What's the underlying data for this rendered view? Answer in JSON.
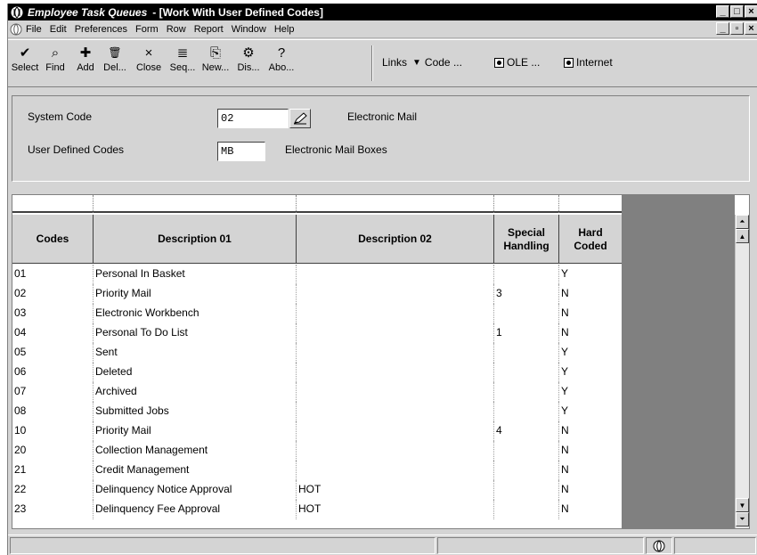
{
  "titlebar": {
    "app_title": "Employee Task Queues",
    "form_title": "- [Work With User Defined Codes]",
    "controls": [
      "_",
      "□",
      "×"
    ]
  },
  "menubar": {
    "items": [
      "File",
      "Edit",
      "Preferences",
      "Form",
      "Row",
      "Report",
      "Window",
      "Help"
    ],
    "mdi_controls": [
      "_",
      "▫",
      "×"
    ]
  },
  "toolbar": {
    "buttons": [
      {
        "label": "Select",
        "icon": "checkmark-icon",
        "glyph": "✔"
      },
      {
        "label": "Find",
        "icon": "find-icon",
        "glyph": "⌕"
      },
      {
        "label": "Add",
        "icon": "add-icon",
        "glyph": "✚"
      },
      {
        "label": "Del...",
        "icon": "trash-icon",
        "glyph": "🗑"
      },
      {
        "label": "Close",
        "icon": "close-icon",
        "glyph": "×"
      },
      {
        "label": "Seq...",
        "icon": "sequence-icon",
        "glyph": "≣"
      },
      {
        "label": "New...",
        "icon": "new-icon",
        "glyph": "⎘"
      },
      {
        "label": "Dis...",
        "icon": "display-icon",
        "glyph": "⚙"
      },
      {
        "label": "Abo...",
        "icon": "about-icon",
        "glyph": "?"
      }
    ],
    "links_label": "Links",
    "code_label": "Code ...",
    "ole_label": "OLE ...",
    "internet_label": "Internet"
  },
  "form": {
    "system_code_label": "System Code",
    "system_code_value": "02",
    "system_code_desc": "Electronic Mail",
    "udc_label": "User Defined Codes",
    "udc_value": "MB",
    "udc_desc": "Electronic Mail Boxes"
  },
  "grid": {
    "headers": {
      "codes": "Codes",
      "desc1": "Description 01",
      "desc2": "Description 02",
      "special_1": "Special",
      "special_2": "Handling",
      "hard_1": "Hard",
      "hard_2": "Coded"
    },
    "rows": [
      {
        "code": "01",
        "desc1": "Personal In Basket",
        "desc2": "",
        "special": "",
        "hard": "Y"
      },
      {
        "code": "02",
        "desc1": "Priority Mail",
        "desc2": "",
        "special": "3",
        "hard": "N"
      },
      {
        "code": "03",
        "desc1": "Electronic Workbench",
        "desc2": "",
        "special": "",
        "hard": "N"
      },
      {
        "code": "04",
        "desc1": "Personal To Do List",
        "desc2": "",
        "special": "1",
        "hard": "N"
      },
      {
        "code": "05",
        "desc1": "Sent",
        "desc2": "",
        "special": "",
        "hard": "Y"
      },
      {
        "code": "06",
        "desc1": "Deleted",
        "desc2": "",
        "special": "",
        "hard": "Y"
      },
      {
        "code": "07",
        "desc1": "Archived",
        "desc2": "",
        "special": "",
        "hard": "Y"
      },
      {
        "code": "08",
        "desc1": "Submitted Jobs",
        "desc2": "",
        "special": "",
        "hard": "Y"
      },
      {
        "code": "10",
        "desc1": "Priority Mail",
        "desc2": "",
        "special": "4",
        "hard": "N"
      },
      {
        "code": "20",
        "desc1": "Collection Management",
        "desc2": "",
        "special": "",
        "hard": "N"
      },
      {
        "code": "21",
        "desc1": "Credit Management",
        "desc2": "",
        "special": "",
        "hard": "N"
      },
      {
        "code": "22",
        "desc1": "Delinquency Notice Approval",
        "desc2": "HOT",
        "special": "",
        "hard": "N"
      },
      {
        "code": "23",
        "desc1": "Delinquency Fee Approval",
        "desc2": "HOT",
        "special": "",
        "hard": "N"
      }
    ]
  },
  "colors": {
    "chrome": "#d4d4d4",
    "titlebar": "#000000",
    "grid_bg": "#ffffff",
    "grid_empty": "#808080"
  }
}
